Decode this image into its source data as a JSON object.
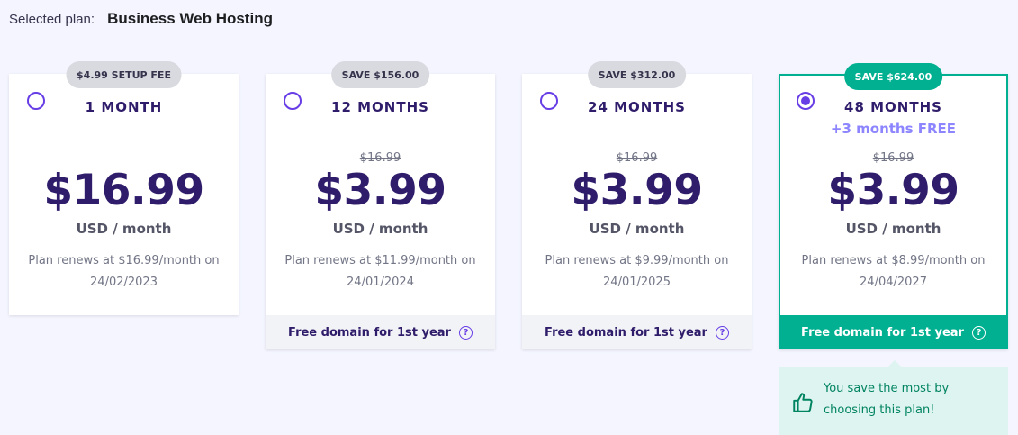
{
  "header": {
    "label": "Selected plan:",
    "plan_name": "Business Web Hosting"
  },
  "plans": [
    {
      "badge": "$4.99 SETUP FEE",
      "term": "1 MONTH",
      "bonus": "",
      "old_price": "",
      "price": "$16.99",
      "unit": "USD / month",
      "renew_line1": "Plan renews at $16.99/month on",
      "renew_line2": "24/02/2023",
      "footer": "",
      "selected": false
    },
    {
      "badge": "SAVE $156.00",
      "term": "12 MONTHS",
      "bonus": "",
      "old_price": "$16.99",
      "price": "$3.99",
      "unit": "USD / month",
      "renew_line1": "Plan renews at $11.99/month on",
      "renew_line2": "24/01/2024",
      "footer": "Free domain for 1st year",
      "selected": false
    },
    {
      "badge": "SAVE $312.00",
      "term": "24 MONTHS",
      "bonus": "",
      "old_price": "$16.99",
      "price": "$3.99",
      "unit": "USD / month",
      "renew_line1": "Plan renews at $9.99/month on",
      "renew_line2": "24/01/2025",
      "footer": "Free domain for 1st year",
      "selected": false
    },
    {
      "badge": "SAVE $624.00",
      "term": "48 MONTHS",
      "bonus": "+3 months FREE",
      "old_price": "$16.99",
      "price": "$3.99",
      "unit": "USD / month",
      "renew_line1": "Plan renews at $8.99/month on",
      "renew_line2": "24/04/2027",
      "footer": "Free domain for 1st year",
      "selected": true
    }
  ],
  "help_icon": "?",
  "tip": {
    "line1": "You save the most by",
    "line2": "choosing this plan!",
    "icon": "thumbs-up-icon"
  },
  "colors": {
    "accent": "#673de6",
    "green": "#00b090",
    "text": "#2f1c6a"
  }
}
